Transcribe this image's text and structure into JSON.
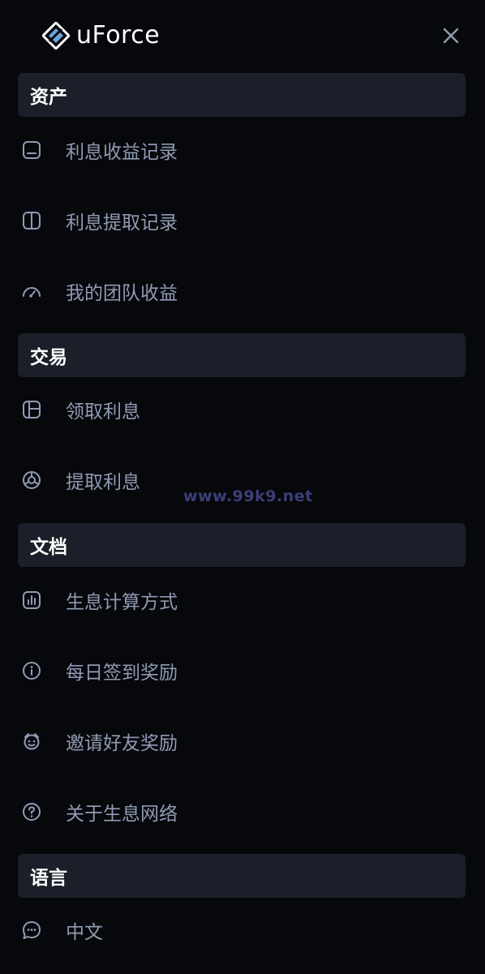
{
  "app": {
    "name": "uForce"
  },
  "menu": {
    "sections": [
      {
        "title": "资产",
        "items": [
          {
            "label": "利息收益记录",
            "icon": "tablet-icon"
          },
          {
            "label": "利息提取记录",
            "icon": "split-panel-icon"
          },
          {
            "label": "我的团队收益",
            "icon": "gauge-icon"
          }
        ]
      },
      {
        "title": "交易",
        "items": [
          {
            "label": "领取利息",
            "icon": "layout-icon"
          },
          {
            "label": "提取利息",
            "icon": "chart-pie-icon"
          }
        ]
      },
      {
        "title": "文档",
        "items": [
          {
            "label": "生息计算方式",
            "icon": "bar-chart-icon"
          },
          {
            "label": "每日签到奖励",
            "icon": "info-icon"
          },
          {
            "label": "邀请好友奖励",
            "icon": "mood-icon"
          },
          {
            "label": "关于生息网络",
            "icon": "help-icon"
          }
        ]
      },
      {
        "title": "语言",
        "items": [
          {
            "label": "中文",
            "icon": "message-dots-icon"
          }
        ]
      }
    ]
  },
  "watermark": "www.99k9.net",
  "colors": {
    "background": "#07080c",
    "section_bg": "#1a1f29",
    "item_text": "#8f9bb3",
    "title_text": "#ffffff",
    "logo_blue": "#6aa6e0"
  }
}
